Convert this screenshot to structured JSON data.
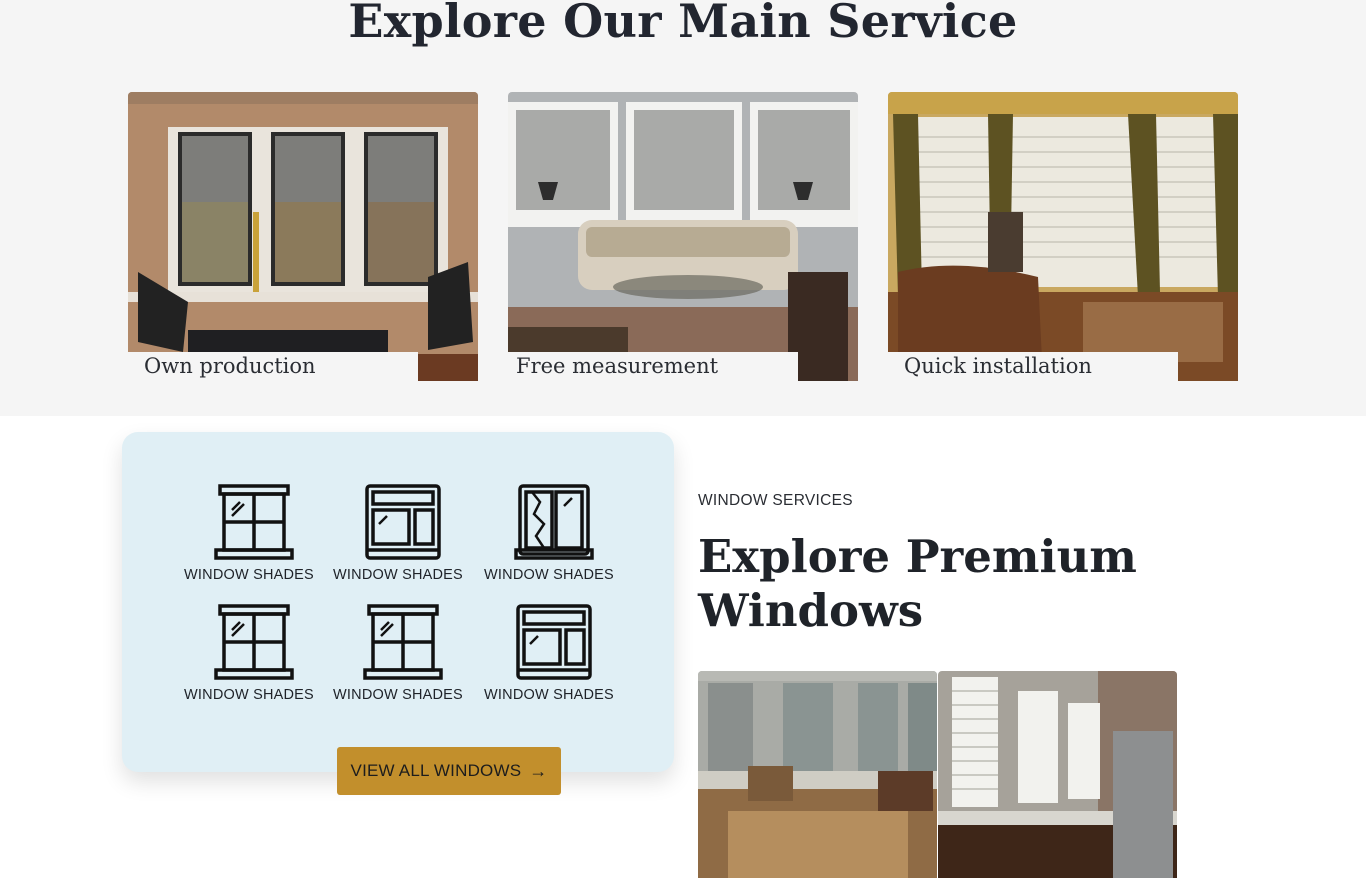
{
  "main_service": {
    "title": "Explore Our Main Service",
    "cards": [
      {
        "caption": "Own production"
      },
      {
        "caption": "Free measurement"
      },
      {
        "caption": "Quick installation"
      }
    ]
  },
  "windows_panel": {
    "tiles": [
      {
        "label": "WINDOW SHADES",
        "icon": "window-four-pane-icon"
      },
      {
        "label": "WINDOW SHADES",
        "icon": "window-transom-icon"
      },
      {
        "label": "WINDOW SHADES",
        "icon": "window-broken-icon"
      },
      {
        "label": "WINDOW SHADES",
        "icon": "window-four-pane-icon"
      },
      {
        "label": "WINDOW SHADES",
        "icon": "window-four-pane-icon"
      },
      {
        "label": "WINDOW SHADES",
        "icon": "window-transom-icon"
      }
    ],
    "button_label": "VIEW ALL WINDOWS",
    "button_arrow": "→",
    "accent": "#c28f2c",
    "panel_bg": "#e0eff5"
  },
  "premium": {
    "eyebrow": "WINDOW SERVICES",
    "title": "Explore Premium Windows"
  }
}
